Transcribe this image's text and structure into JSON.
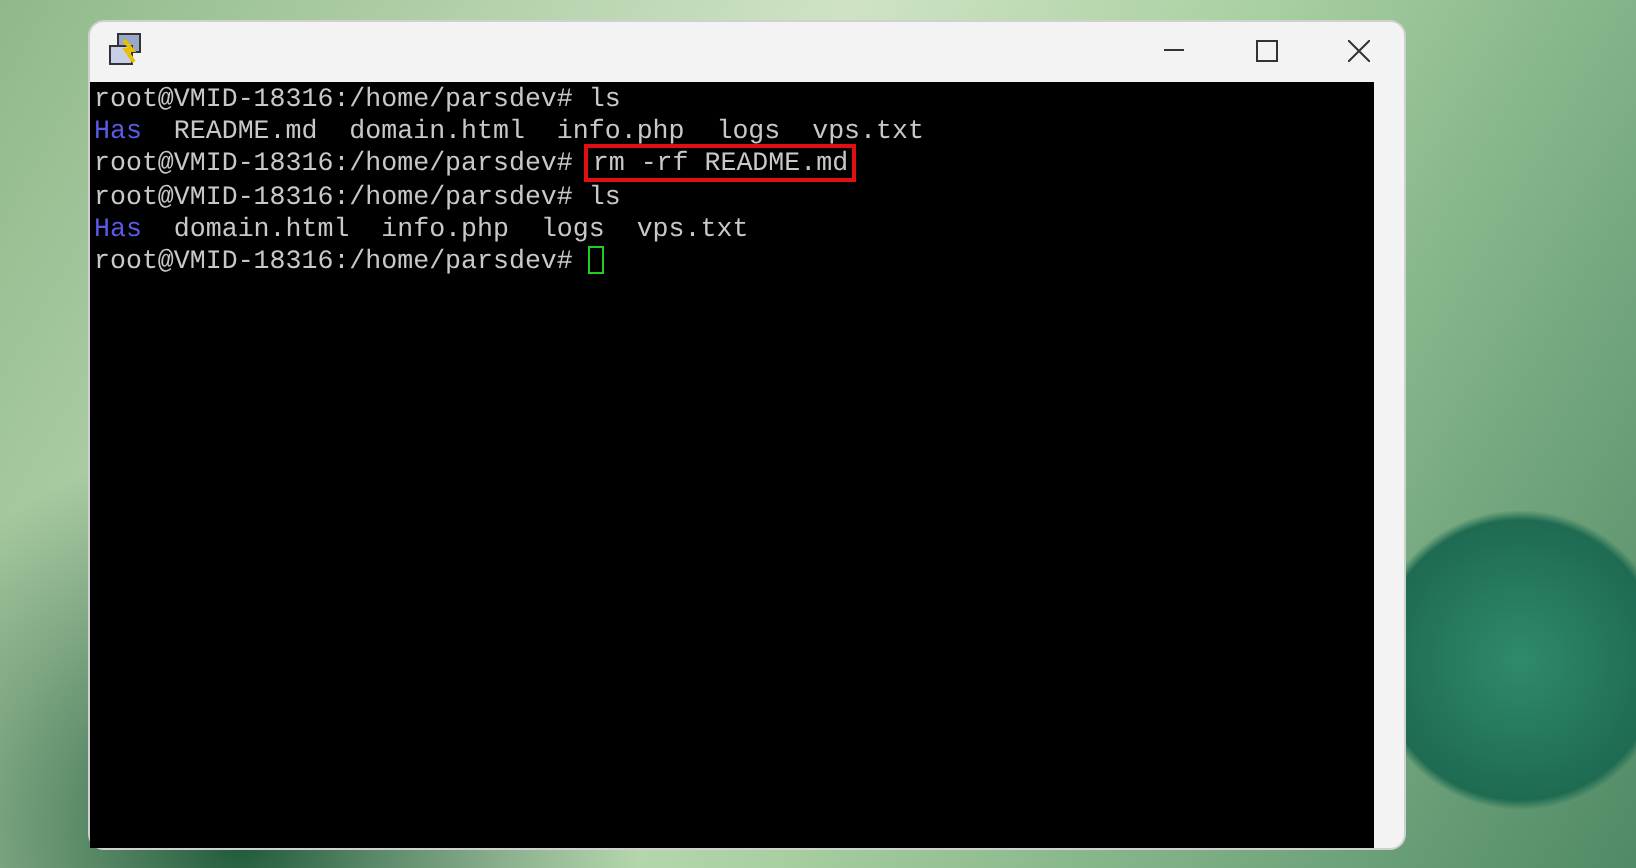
{
  "terminal": {
    "cursor": true,
    "lines": [
      {
        "segments": [
          {
            "kind": "text",
            "text": "root@VMID-18316:/home/parsdev# ls"
          }
        ]
      },
      {
        "segments": [
          {
            "kind": "dir",
            "text": "Has"
          },
          {
            "kind": "text",
            "text": "  README.md  domain.html  info.php  logs  vps.txt"
          }
        ]
      },
      {
        "segments": [
          {
            "kind": "text",
            "text": "root@VMID-18316:/home/parsdev#"
          },
          {
            "kind": "highlighted",
            "text": "rm -rf README.md"
          }
        ]
      },
      {
        "segments": [
          {
            "kind": "text",
            "text": "root@VMID-18316:/home/parsdev# ls"
          }
        ]
      },
      {
        "segments": [
          {
            "kind": "dir",
            "text": "Has"
          },
          {
            "kind": "text",
            "text": "  domain.html  info.php  logs  vps.txt"
          }
        ]
      },
      {
        "segments": [
          {
            "kind": "text",
            "text": "root@VMID-18316:/home/parsdev# "
          }
        ]
      }
    ]
  }
}
